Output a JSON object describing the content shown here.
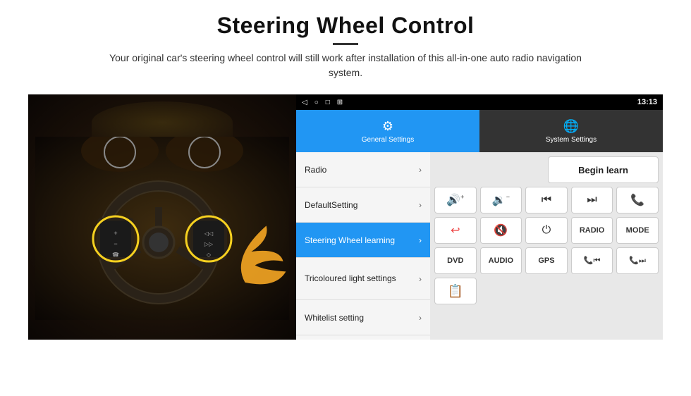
{
  "header": {
    "title": "Steering Wheel Control",
    "subtitle": "Your original car's steering wheel control will still work after installation of this all-in-one auto radio navigation system."
  },
  "statusBar": {
    "time": "13:13",
    "icons": [
      "◁",
      "○",
      "□",
      "⊞"
    ]
  },
  "tabs": [
    {
      "id": "general",
      "label": "General Settings",
      "icon": "⚙",
      "active": true
    },
    {
      "id": "system",
      "label": "System Settings",
      "icon": "🌐",
      "active": false
    }
  ],
  "menu": [
    {
      "id": "radio",
      "label": "Radio",
      "active": false
    },
    {
      "id": "default",
      "label": "DefaultSetting",
      "active": false
    },
    {
      "id": "steering",
      "label": "Steering Wheel learning",
      "active": true
    },
    {
      "id": "tricoloured",
      "label": "Tricoloured light settings",
      "active": false
    },
    {
      "id": "whitelist",
      "label": "Whitelist setting",
      "active": false
    }
  ],
  "controls": {
    "beginLearn": "Begin learn",
    "row1": [
      "🔊+",
      "🔊−",
      "⏮",
      "⏭",
      "📞"
    ],
    "row2": [
      "↩",
      "🔇",
      "⏻",
      "RADIO",
      "MODE"
    ],
    "row3": [
      "DVD",
      "AUDIO",
      "GPS",
      "📞⏮",
      "📞⏭"
    ],
    "whitelistIcon": "📋"
  }
}
